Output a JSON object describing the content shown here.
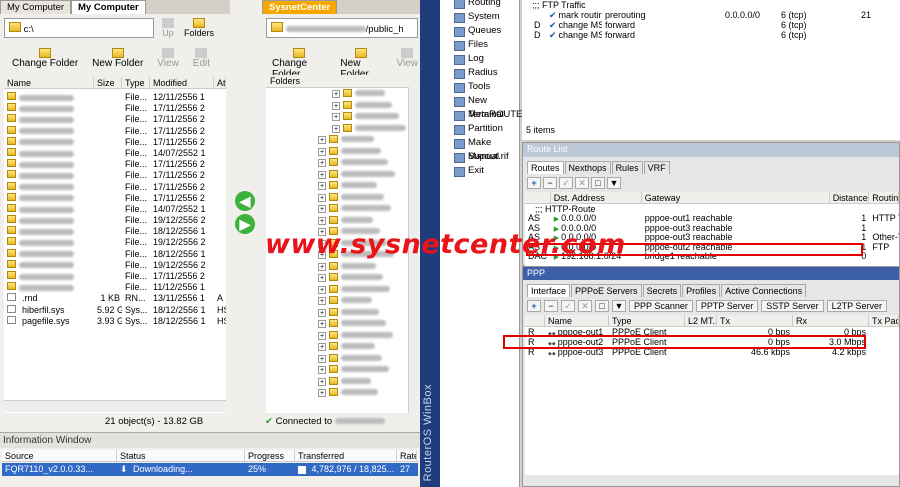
{
  "left": {
    "tabs": [
      "My Computer",
      "My Computer"
    ],
    "path": "c:\\",
    "toolbar": {
      "up": "Up",
      "folders": "Folders",
      "change": "Change Folder",
      "new": "New Folder",
      "view": "View",
      "edit": "Edit"
    },
    "columns": [
      "Name",
      "Size",
      "Type",
      "Modified",
      "At"
    ],
    "rows": [
      {
        "name": "",
        "size": "",
        "type": "File...",
        "date": "12/11/2556 1"
      },
      {
        "name": "",
        "size": "",
        "type": "File...",
        "date": "17/11/2556 2"
      },
      {
        "name": "",
        "size": "",
        "type": "File...",
        "date": "17/11/2556 2"
      },
      {
        "name": "",
        "size": "",
        "type": "File...",
        "date": "17/11/2556 2"
      },
      {
        "name": "",
        "size": "",
        "type": "File...",
        "date": "17/11/2556 2"
      },
      {
        "name": "",
        "size": "",
        "type": "File...",
        "date": "14/07/2552 1"
      },
      {
        "name": "",
        "size": "",
        "type": "File...",
        "date": "17/11/2556 2"
      },
      {
        "name": "",
        "size": "",
        "type": "File...",
        "date": "17/11/2556 2"
      },
      {
        "name": "",
        "size": "",
        "type": "File...",
        "date": "17/11/2556 2"
      },
      {
        "name": "",
        "size": "",
        "type": "File...",
        "date": "17/11/2556 2"
      },
      {
        "name": "",
        "size": "",
        "type": "File...",
        "date": "14/07/2552 1"
      },
      {
        "name": "",
        "size": "",
        "type": "File...",
        "date": "19/12/2556 2"
      },
      {
        "name": "",
        "size": "",
        "type": "File...",
        "date": "18/12/2556 1"
      },
      {
        "name": "",
        "size": "",
        "type": "File...",
        "date": "19/12/2556 2"
      },
      {
        "name": "",
        "size": "",
        "type": "File...",
        "date": "18/12/2556 1"
      },
      {
        "name": "",
        "size": "",
        "type": "File...",
        "date": "19/12/2556 2"
      },
      {
        "name": "",
        "size": "",
        "type": "File...",
        "date": "17/11/2556 2"
      },
      {
        "name": "",
        "size": "",
        "type": "File...",
        "date": "11/12/2556 1"
      },
      {
        "name": ".rnd",
        "size": "1 KB",
        "type": "RN...",
        "date": "13/11/2556 1",
        "at": "A"
      },
      {
        "name": "hiberfil.sys",
        "size": "5.92 GB",
        "type": "Sys...",
        "date": "18/12/2556 1",
        "at": "HS"
      },
      {
        "name": "pagefile.sys",
        "size": "3.93 GB",
        "type": "Sys...",
        "date": "18/12/2556 1",
        "at": "HS"
      }
    ],
    "status": "21 object(s) - 13.82 GB"
  },
  "mid": {
    "tab": "SysnetCenter",
    "path": "/public_h",
    "toolbar": {
      "change": "Change Folder",
      "new": "New Folder",
      "view": "View"
    },
    "folders_label": "Folders",
    "status": "Connected to"
  },
  "info": {
    "title": "Information Window",
    "columns": [
      "Source",
      "Status",
      "Progress",
      "Transferred",
      "Rate"
    ],
    "row": {
      "source": "FQR7110_v2.0.0.33...",
      "status": "Downloading...",
      "progress": "25%",
      "progress_value": 0.25,
      "transferred": "4,782,976 / 18,825...",
      "rate": "27"
    }
  },
  "winbox": {
    "vertical": "RouterOS WinBox",
    "menu": [
      "Routing",
      "System",
      "Queues",
      "Files",
      "Log",
      "Radius",
      "Tools",
      "New Terminal",
      "MetaROUTER",
      "Partition",
      "Make Supout.rif",
      "Manual",
      "Exit"
    ],
    "mangle": {
      "comment": ";;; FTP Traffic",
      "rows": [
        {
          "n": "2",
          "action": "mark routing",
          "chain": "prerouting",
          "dst": "0.0.0.0/0",
          "proto": "6 (tcp)",
          "port": "21"
        },
        {
          "n": "3",
          "flag": "D",
          "action": "change MSS",
          "chain": "forward",
          "proto": "6 (tcp)"
        },
        {
          "n": "4",
          "flag": "D",
          "action": "change MSS",
          "chain": "forward",
          "proto": "6 (tcp)"
        }
      ],
      "count": "5 items"
    },
    "route": {
      "title": "Route List",
      "tabs": [
        "Routes",
        "Nexthops",
        "Rules",
        "VRF"
      ],
      "columns": [
        "",
        "Dst. Address",
        "Gateway",
        "Distance",
        "Routing"
      ],
      "comment": ";;; HTTP-Route",
      "rows": [
        {
          "f": "AS",
          "dst": "0.0.0.0/0",
          "gw": "pppoe-out1 reachable",
          "d": "1",
          "r": "HTTP Tr"
        },
        {
          "f": "AS",
          "dst": "0.0.0.0/0",
          "gw": "pppoe-out3 reachable",
          "d": "1",
          "r": ""
        },
        {
          "f": "AS",
          "dst": "0.0.0.0/0",
          "gw": "pppoe-out3 reachable",
          "d": "1",
          "r": "Other-T"
        },
        {
          "f": "AS",
          "dst": "0.0.0.0/0",
          "gw": "pppoe-out2 reachable",
          "d": "1",
          "r": "FTP"
        },
        {
          "f": "DAC",
          "dst": "192.168.1.0/24",
          "gw": "bridge1 reachable",
          "d": "0",
          "r": ""
        }
      ]
    },
    "ppp": {
      "title": "PPP",
      "tabs": [
        "Interface",
        "PPPoE Servers",
        "Secrets",
        "Profiles",
        "Active Connections"
      ],
      "buttons": [
        "PPP Scanner",
        "PPTP Server",
        "SSTP Server",
        "L2TP Server"
      ],
      "columns": [
        "",
        "Name",
        "Type",
        "L2 MT...",
        "Tx",
        "Rx",
        "Tx Pack"
      ],
      "rows": [
        {
          "f": "R",
          "name": "pppoe-out1",
          "type": "PPPoE Client",
          "tx": "0 bps",
          "rx": "0 bps"
        },
        {
          "f": "R",
          "name": "pppoe-out2",
          "type": "PPPoE Client",
          "tx": "0 bps",
          "rx": "3.0 Mbps"
        },
        {
          "f": "R",
          "name": "pppoe-out3",
          "type": "PPPoE Client",
          "tx": "46.6 kbps",
          "rx": "4.2 kbps"
        }
      ]
    }
  },
  "watermark": "www.sysnetcenter.com",
  "colors": {
    "watermark": "#e8141a",
    "highlight": "#e00000",
    "selection": "#3169c6"
  }
}
